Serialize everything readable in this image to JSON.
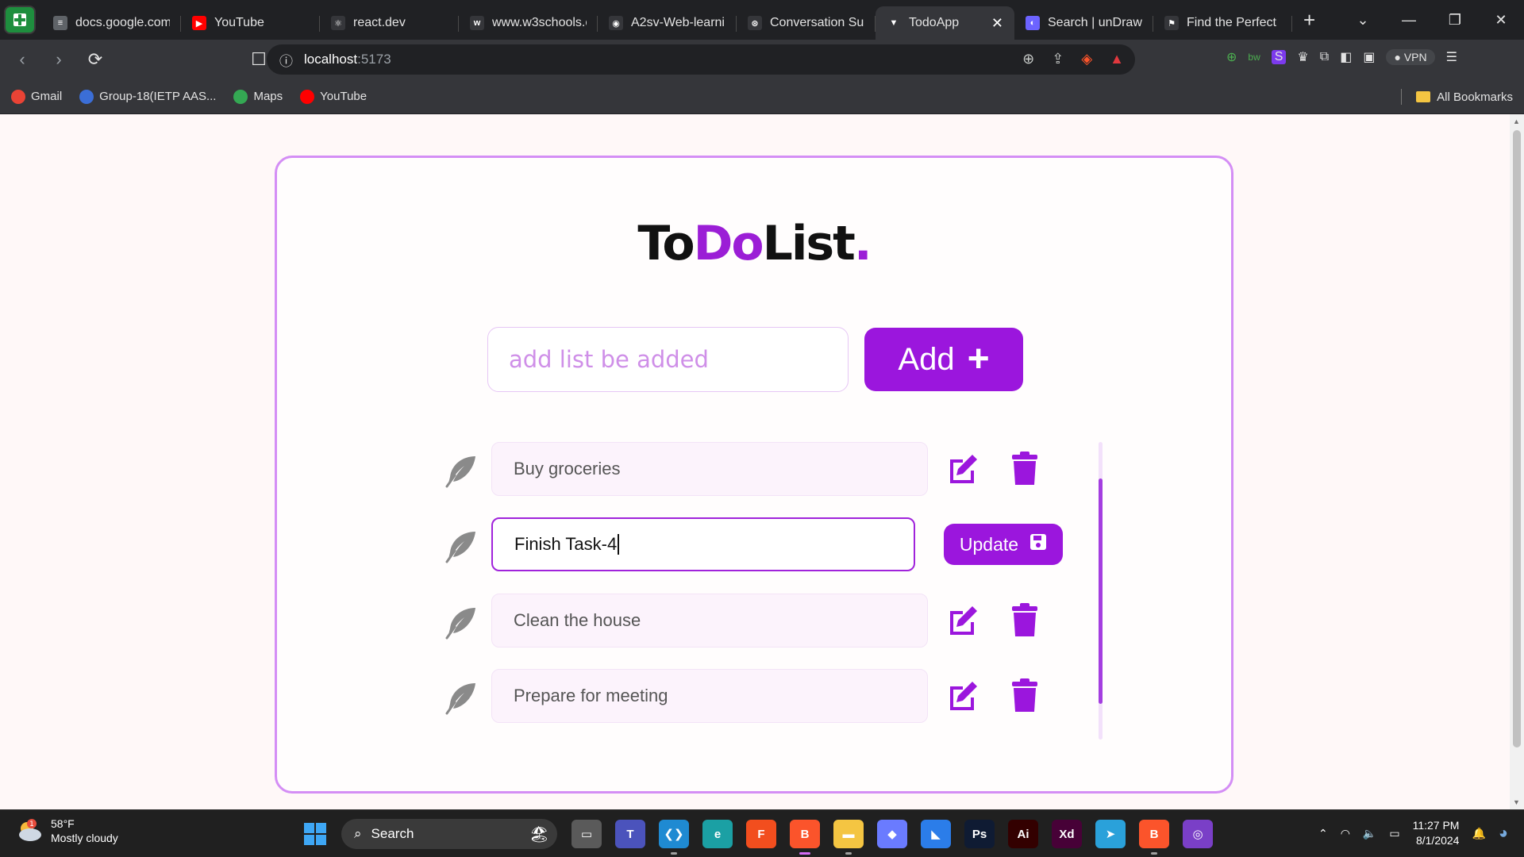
{
  "browser": {
    "tabs": [
      {
        "label": "docs.google.com",
        "fav_color": "#5f6368",
        "fav_text": "≡"
      },
      {
        "label": "YouTube",
        "fav_color": "#ff0000",
        "fav_text": "▶"
      },
      {
        "label": "react.dev",
        "fav_color": "#35363a",
        "fav_text": "⚛"
      },
      {
        "label": "www.w3schools.c",
        "fav_color": "#35363a",
        "fav_text": "w"
      },
      {
        "label": "A2sv-Web-learni",
        "fav_color": "#35363a",
        "fav_text": "◉"
      },
      {
        "label": "Conversation Su",
        "fav_color": "#35363a",
        "fav_text": "⊛"
      },
      {
        "label": "TodoApp",
        "fav_color": "#35363a",
        "fav_text": "▼",
        "active": true
      },
      {
        "label": "Search | unDraw",
        "fav_color": "#6c63ff",
        "fav_text": "◐"
      },
      {
        "label": "Find the Perfect",
        "fav_color": "#35363a",
        "fav_text": "⚑"
      }
    ],
    "url_host": "localhost",
    "url_port": ":5173",
    "bookmarks": [
      {
        "label": "Gmail",
        "color": "#ea4335"
      },
      {
        "label": "Group-18(IETP AAS...",
        "color": "#3b6ed6"
      },
      {
        "label": "Maps",
        "color": "#34a853"
      },
      {
        "label": "YouTube",
        "color": "#ff0000"
      }
    ],
    "all_bookmarks": "All Bookmarks",
    "vpn": "VPN"
  },
  "app": {
    "title_part1": "To",
    "title_part2": "Do",
    "title_part3": "List",
    "title_dot": ".",
    "input_placeholder": "add list be added",
    "add_label": "Add",
    "add_icon": "+",
    "update_label": "Update",
    "accent_color": "#9b16dd",
    "tasks": [
      {
        "text": "Buy groceries",
        "editing": false
      },
      {
        "text": "Finish Task-4",
        "editing": true
      },
      {
        "text": "Clean the house",
        "editing": false
      },
      {
        "text": "Prepare for meeting",
        "editing": false
      }
    ]
  },
  "taskbar": {
    "temperature": "58°F",
    "weather": "Mostly cloudy",
    "weather_badge": "1",
    "search": "Search",
    "time": "11:27 PM",
    "date": "8/1/2024",
    "apps": [
      {
        "name": "file-explorer-dark",
        "color": "#5a5a5a",
        "glyph": "▭"
      },
      {
        "name": "teams",
        "color": "#4b53bc",
        "glyph": "T"
      },
      {
        "name": "vscode",
        "color": "#1f8ad2",
        "glyph": "❮❯"
      },
      {
        "name": "edge",
        "color": "#1ba0a4",
        "glyph": "e"
      },
      {
        "name": "figma",
        "color": "#f24e1e",
        "glyph": "F"
      },
      {
        "name": "brave",
        "color": "#fb542b",
        "glyph": "B"
      },
      {
        "name": "folder",
        "color": "#f4c542",
        "glyph": "▬"
      },
      {
        "name": "app-notes",
        "color": "#6a7bff",
        "glyph": "◆"
      },
      {
        "name": "framer",
        "color": "#2b7de9",
        "glyph": "◣"
      },
      {
        "name": "photoshop",
        "color": "#0f1b33",
        "glyph": "Ps"
      },
      {
        "name": "illustrator",
        "color": "#330000",
        "glyph": "Ai"
      },
      {
        "name": "xd",
        "color": "#470137",
        "glyph": "Xd"
      },
      {
        "name": "telegram",
        "color": "#2aa1da",
        "glyph": "➤"
      },
      {
        "name": "brave-2",
        "color": "#fb542b",
        "glyph": "B"
      },
      {
        "name": "github-desktop",
        "color": "#7a3fc7",
        "glyph": "◎"
      }
    ]
  }
}
